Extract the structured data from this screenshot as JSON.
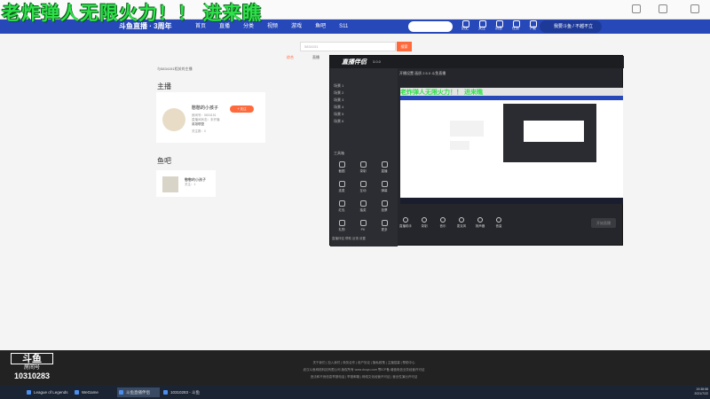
{
  "overlay_text": "老炸弹人无限火力！！ 进来瞧",
  "browser": {
    "icons": [
      "star-icon",
      "extension-icon",
      "menu-icon"
    ]
  },
  "header": {
    "logo": "斗鱼直播 · 3周年",
    "nav": [
      "首页",
      "直播",
      "分类",
      "视频",
      "游戏",
      "鱼吧",
      "S11"
    ],
    "icons": [
      {
        "name": "history-icon",
        "label": "历史"
      },
      {
        "name": "follow-icon",
        "label": "关注"
      },
      {
        "name": "message-icon",
        "label": "消息"
      },
      {
        "name": "task-icon",
        "label": "任务"
      },
      {
        "name": "download-icon",
        "label": "下载"
      },
      {
        "name": "upload-icon",
        "label": "开播"
      }
    ],
    "promo": "我要斗鱼 / 不越不立"
  },
  "search": {
    "value": "5834151",
    "button": "搜索",
    "tabs": [
      "综合",
      "直播"
    ]
  },
  "breadcrumb": "与5834151相关的主播",
  "anchor": {
    "section": "主播",
    "name": "憨憨的小孩子",
    "line1": "房间号：5834151",
    "line2": "直播间状态：未开播",
    "line3": "英雄联盟",
    "follow": "+ 关注",
    "meta": "关注数：0"
  },
  "fishbar": {
    "section": "鱼吧",
    "name": "憨憨的小孩子",
    "meta": "关注：1"
  },
  "obs": {
    "app": "直播伴侣",
    "version": "3.0.0",
    "topbar": "开播设置  画质  2.5.0  斗鱼直播",
    "scenes": [
      "场景 1",
      "场景 2",
      "场景 3",
      "场景 4",
      "场景 5",
      "场景 6"
    ],
    "tools_title": "工具箱",
    "tools": [
      "截图",
      "录制",
      "直播",
      "连麦",
      "互动",
      "弹幕",
      "红包",
      "抽奖",
      "投票",
      "礼物",
      "PK",
      "更多"
    ],
    "controls": [
      "直播助手",
      "录制",
      "音乐",
      "麦克风",
      "扬声器",
      "音量"
    ],
    "start": "开始直播",
    "footer": "直播伴侣  帮助  反馈  设置"
  },
  "footer_lines": [
    "关于我们 | 加入我们 | 商务合作 | 用户协议 | 隐私政策 | 主播招募 | 帮助中心",
    "武汉斗鱼网络科技有限公司 版权所有 www.douyu.com 鄂ICP备 增值电信业务经营许可证",
    "违法和不良信息举报电话 | 举报邮箱 | 网络文化经营许可证 | 营业性演出许可证"
  ],
  "room": {
    "logo": "斗鱼",
    "label": "房间号",
    "number": "10310283"
  },
  "taskbar": {
    "items": [
      "League of Legends",
      "WeGame",
      "斗鱼直播伴侣",
      "10310283 - 斗鱼"
    ],
    "time": "19:38:58",
    "date": "2021/7/22"
  }
}
